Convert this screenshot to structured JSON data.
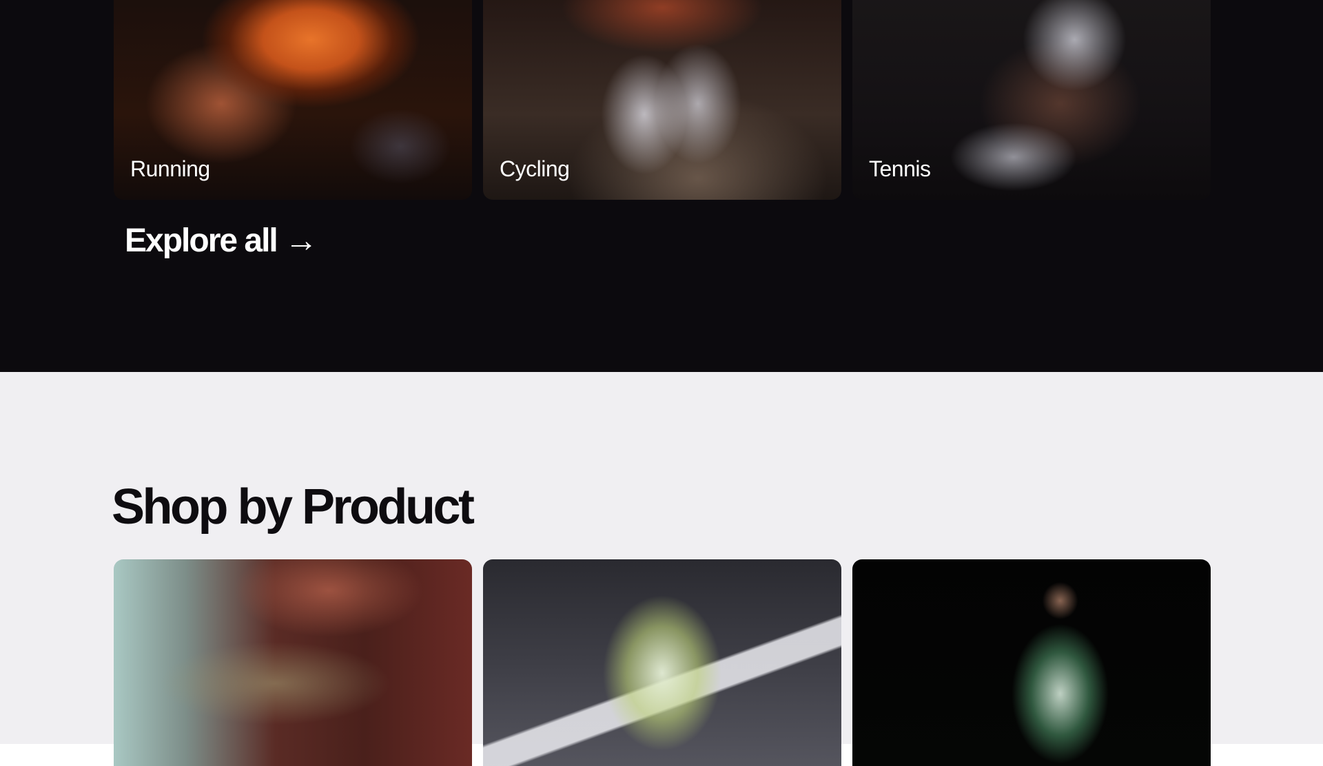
{
  "sports": {
    "cards": [
      {
        "label": "Running"
      },
      {
        "label": "Cycling"
      },
      {
        "label": "Tennis"
      }
    ],
    "explore_link": "Explore all →"
  },
  "products": {
    "title": "Shop by Product",
    "cards": [
      {
        "image": "sunglasses-photo"
      },
      {
        "image": "reflective-jacket-photo"
      },
      {
        "image": "hoodie-photo"
      }
    ]
  },
  "colors": {
    "dark_background": "#0c0a0e",
    "light_background": "#f0eff2",
    "text_light": "#ffffff",
    "text_dark": "#0e0c10"
  }
}
